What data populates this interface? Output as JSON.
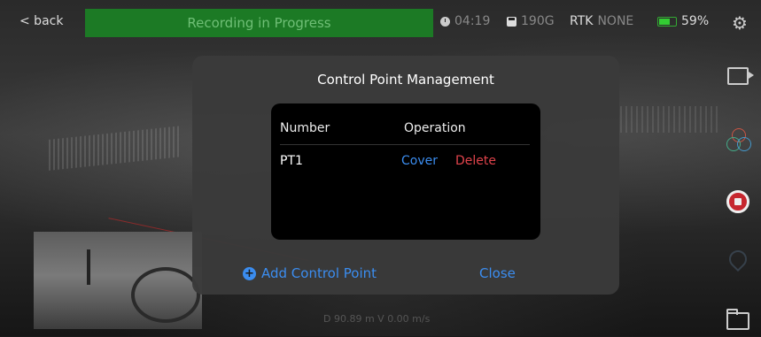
{
  "topbar": {
    "back_label": "< back",
    "recording_banner": "Recording in Progress",
    "elapsed_time": "04:19",
    "storage": "190G",
    "rtk_label": "RTK",
    "rtk_status": "NONE",
    "battery": "59%"
  },
  "dialog": {
    "title": "Control Point Management",
    "columns": [
      "Number",
      "Operation"
    ],
    "rows": [
      {
        "number": "PT1",
        "cover_label": "Cover",
        "delete_label": "Delete"
      }
    ],
    "add_label": "Add Control Point",
    "close_label": "Close"
  },
  "readout": "D 90.89 m V 0.00 m/s",
  "icons": {
    "settings": "gear-icon",
    "camera": "camera-icon",
    "layers": "layers-icon",
    "record_stop": "record-stop-icon",
    "location": "location-pin-icon",
    "folder": "folder-icon",
    "add": "plus-circle-icon"
  },
  "colors": {
    "recording_bg": "#1c7a25",
    "accent_blue": "#3b8df0",
    "delete_red": "#e0434b",
    "record_red": "#c6262e",
    "battery_green": "#33cc33"
  }
}
